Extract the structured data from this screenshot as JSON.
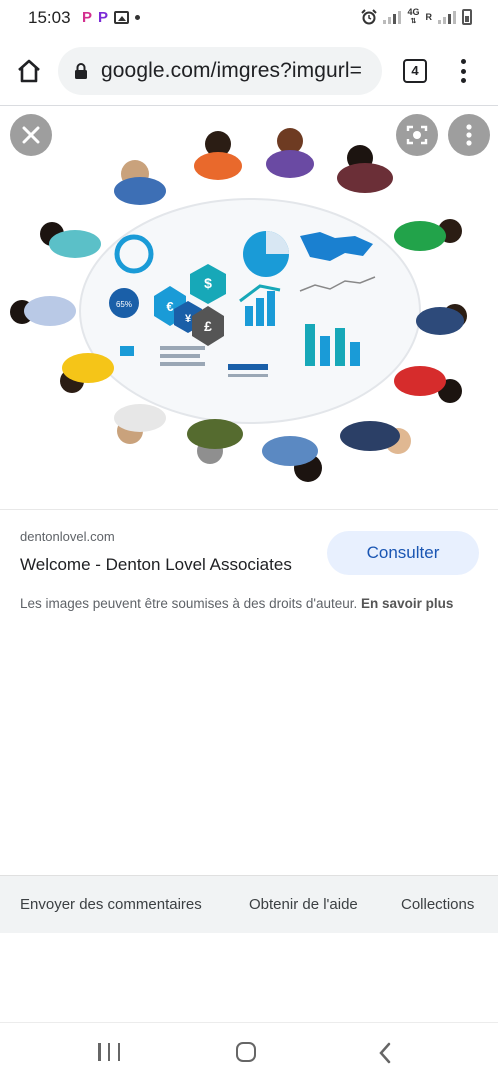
{
  "status_bar": {
    "time": "15:03",
    "left_icons": [
      "p-app-icon",
      "p-app-icon",
      "gallery-icon",
      "dot-icon"
    ],
    "net_top": "4G",
    "net_bottom": "R",
    "right_icons": [
      "alarm-icon",
      "signal-icon",
      "signal-icon",
      "battery-icon"
    ]
  },
  "browser": {
    "url": "google.com/imgres?imgurl=",
    "tab_count": "4"
  },
  "image": {
    "accent_colors": [
      "#1a9bd7",
      "#17a8b8",
      "#f5c518",
      "#d62c2c"
    ]
  },
  "result": {
    "domain": "dentonlovel.com",
    "title": "Welcome - Denton Lovel Associates",
    "consult_label": "Consulter",
    "copyright_text": "Les images peuvent être soumises à des droits d'auteur.",
    "copyright_link": "En savoir plus"
  },
  "footer": {
    "feedback": "Envoyer des commentaires",
    "help": "Obtenir de l'aide",
    "collections": "Collections"
  },
  "illustration": {
    "percent_label": "65%",
    "currency_symbols": [
      "$",
      "€",
      "¥",
      "£"
    ]
  }
}
